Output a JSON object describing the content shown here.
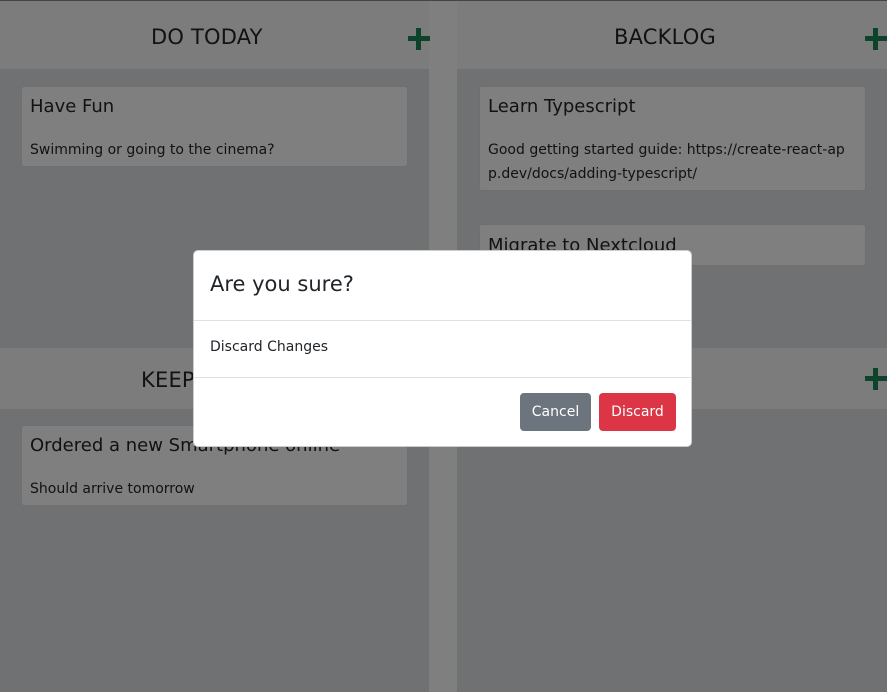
{
  "columns": [
    {
      "title": "DO TODAY",
      "cards": [
        {
          "title": "Have Fun",
          "text": "Swimming or going to the cinema?"
        }
      ]
    },
    {
      "title": "BACKLOG",
      "cards": [
        {
          "title": "Learn Typescript",
          "text": "Good getting started guide: https://create-react-app.dev/docs/adding-typescript/"
        },
        {
          "title": "Migrate to Nextcloud",
          "text": ""
        }
      ]
    },
    {
      "title": "KEEP",
      "cards": [
        {
          "title": "Ordered a new Smartphone online",
          "text": "Should arrive tomorrow"
        }
      ]
    },
    {
      "title": "",
      "cards": []
    }
  ],
  "icons": {
    "add": "plus-icon"
  },
  "modal": {
    "title": "Are you sure?",
    "body": "Discard Changes",
    "cancel_label": "Cancel",
    "discard_label": "Discard"
  },
  "colors": {
    "add_icon": "#198754",
    "cancel_button": "#6c757d",
    "discard_button": "#dc3545",
    "column_background": "#dee2e6",
    "header_background": "#f8f9fa"
  }
}
